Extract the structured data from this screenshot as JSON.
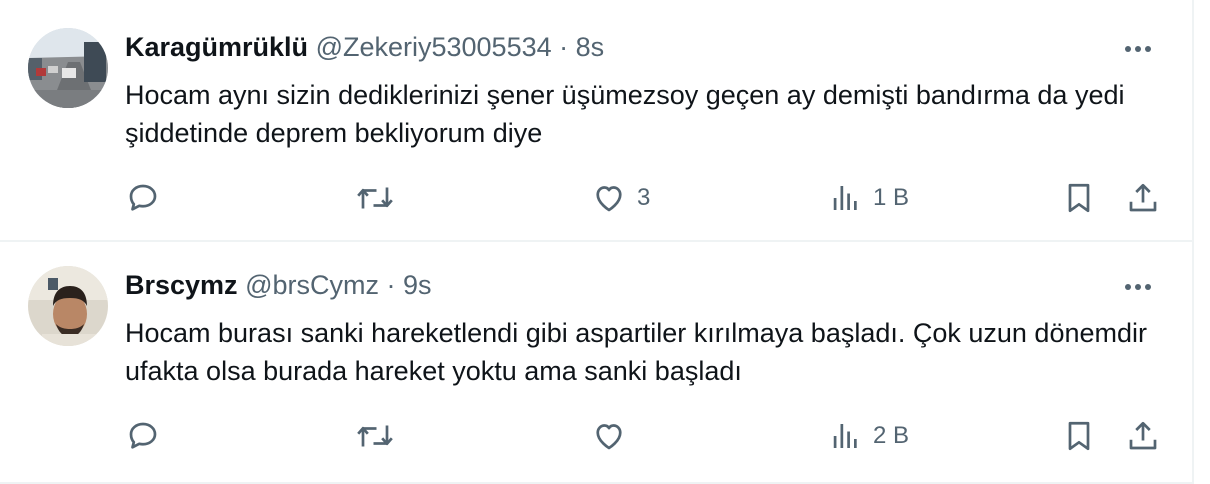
{
  "tweets": [
    {
      "name": "Karagümrüklü",
      "handle": "@Zekeriy53005534",
      "separator": "·",
      "time": "8s",
      "text": "Hocam aynı sizin dediklerinizi şener üşümezsoy geçen ay demişti bandırma da yedi şiddetinde deprem bekliyorum diye",
      "likes": "3",
      "views": "1 B",
      "avatar": "road-traffic-photo"
    },
    {
      "name": "Brscymz",
      "handle": "@brsCymz",
      "separator": "·",
      "time": "9s",
      "text": "Hocam burası sanki hareketlendi gibi aspartiler kırılmaya başladı. Çok uzun dönemdir ufakta olsa burada hareket yoktu ama sanki başladı",
      "likes": "",
      "views": "2 B",
      "avatar": "man-portrait-photo"
    }
  ],
  "icons": {
    "reply": "reply-icon",
    "retweet": "retweet-icon",
    "like": "heart-icon",
    "views": "views-icon",
    "bookmark": "bookmark-icon",
    "share": "share-icon",
    "more": "more-icon"
  },
  "colors": {
    "text": "#0f1419",
    "secondary": "#536471",
    "divider": "#eff3f4"
  }
}
